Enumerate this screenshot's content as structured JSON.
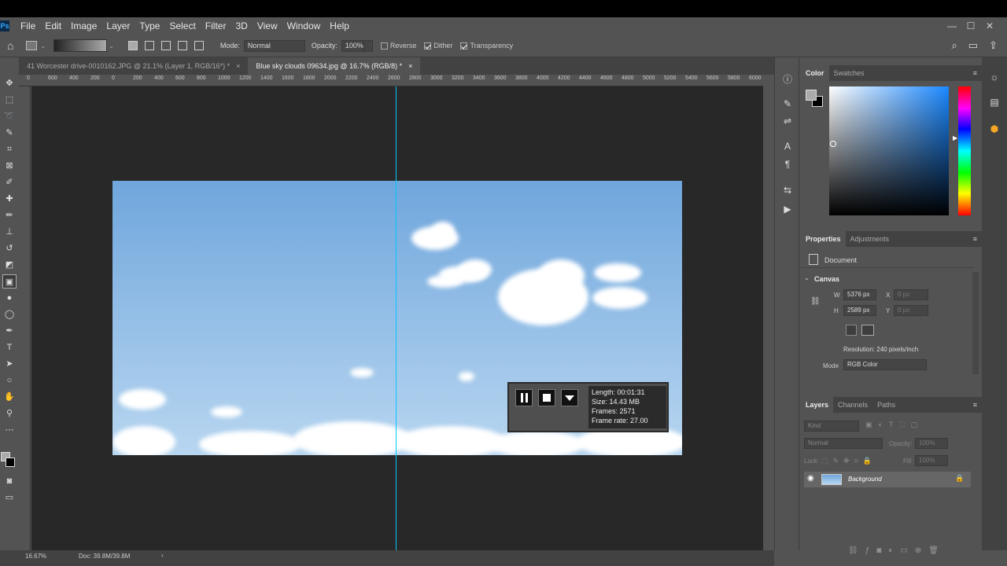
{
  "app": {
    "logo": "Ps"
  },
  "menu": [
    "File",
    "Edit",
    "Image",
    "Layer",
    "Type",
    "Select",
    "Filter",
    "3D",
    "View",
    "Window",
    "Help"
  ],
  "window_controls": {
    "minimize": "—",
    "maximize": "☐",
    "close": "✕"
  },
  "options_bar": {
    "mode_label": "Mode:",
    "mode_value": "Normal",
    "opacity_label": "Opacity:",
    "opacity_value": "100%",
    "reverse_label": "Reverse",
    "reverse_checked": false,
    "dither_label": "Dither",
    "dither_checked": true,
    "transparency_label": "Transparency",
    "transparency_checked": true
  },
  "tabs": [
    {
      "title": "41 Worcester drive-0010162.JPG @ 21.1% (Layer 1, RGB/16*) *",
      "close": "×"
    },
    {
      "title": "Blue sky clouds 09634.jpg @ 16.7% (RGB/8) *",
      "close": "×",
      "active": true
    }
  ],
  "ruler_labels": [
    "0",
    "600",
    "400",
    "200",
    "0",
    "200",
    "400",
    "600",
    "800",
    "1000",
    "1200",
    "1400",
    "1600",
    "1800",
    "2000",
    "2200",
    "2400",
    "2600",
    "2800",
    "3000",
    "3200",
    "3400",
    "3600",
    "3800",
    "4000",
    "4200",
    "4400",
    "4600",
    "4800",
    "5000",
    "5200",
    "5400",
    "5600",
    "5800",
    "6000"
  ],
  "recorder": {
    "length": "Length: 00:01:31",
    "size": "Size: 14.43 MB",
    "frames": "Frames: 2571",
    "frame_rate": "Frame rate: 27.00"
  },
  "color_panel": {
    "tab_color": "Color",
    "tab_swatches": "Swatches"
  },
  "properties": {
    "tab_properties": "Properties",
    "tab_adjustments": "Adjustments",
    "document_label": "Document",
    "canvas_label": "Canvas",
    "w_label": "W",
    "w_value": "5376 px",
    "h_label": "H",
    "h_value": "2589 px",
    "x_label": "X",
    "x_value": "0 px",
    "y_label": "Y",
    "y_value": "0 px",
    "resolution": "Resolution: 240 pixels/inch",
    "mode_label": "Mode",
    "mode_value": "RGB Color"
  },
  "layers": {
    "tab_layers": "Layers",
    "tab_channels": "Channels",
    "tab_paths": "Paths",
    "kind_placeholder": "Kind",
    "blend": "Normal",
    "opacity_label": "Opacity:",
    "opacity_value": "100%",
    "lock_label": "Lock:",
    "fill_label": "Fill:",
    "fill_value": "100%",
    "items": [
      {
        "name": "Background",
        "visible": true,
        "locked": true
      }
    ]
  },
  "status": {
    "zoom": "16.67%",
    "doc": "Doc: 39.8M/39.8M"
  }
}
